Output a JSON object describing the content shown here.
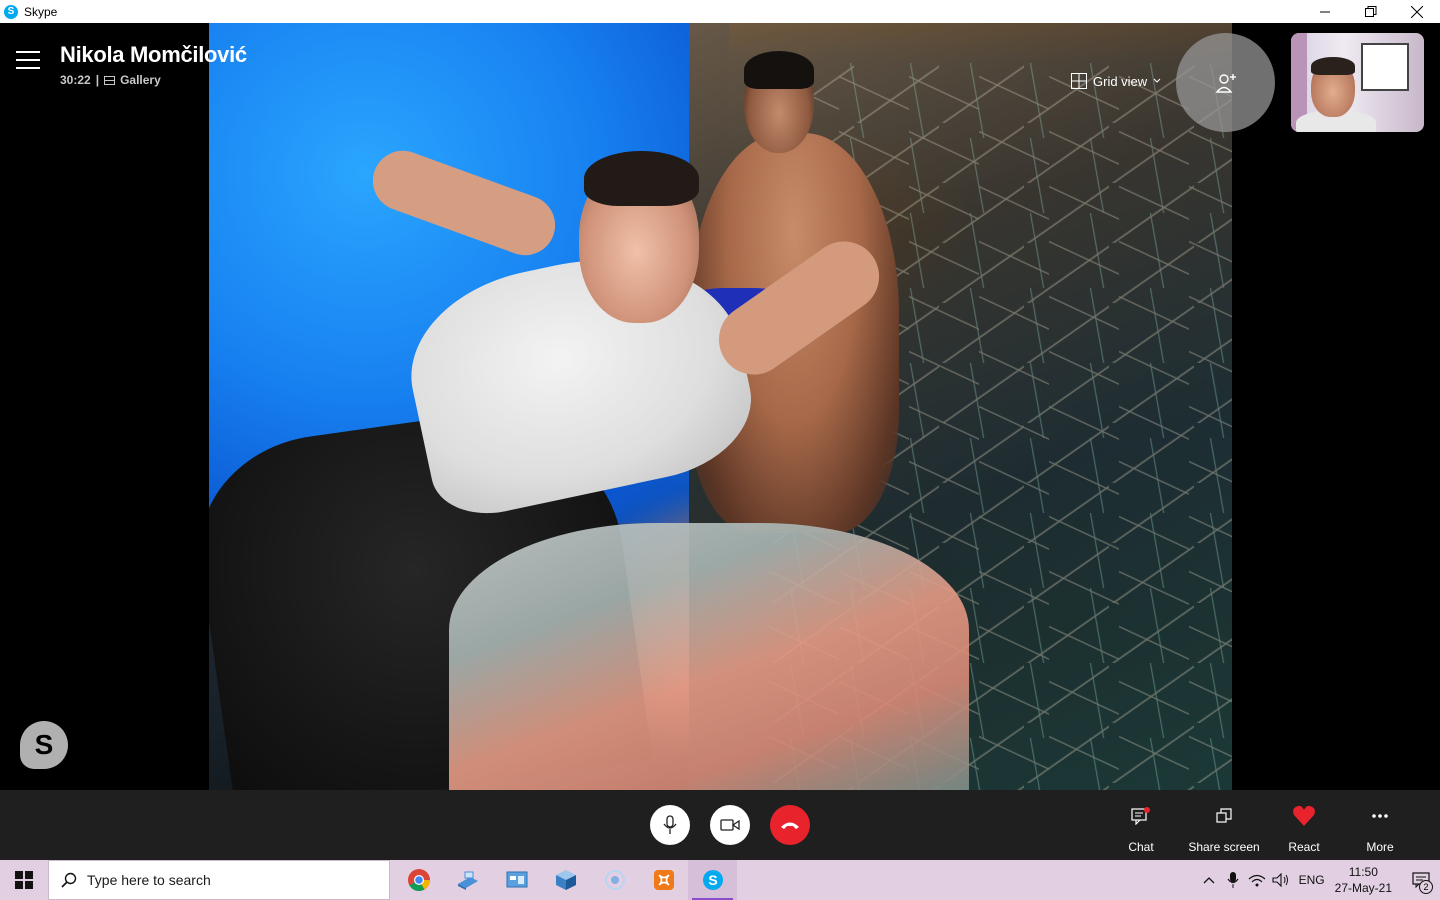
{
  "window": {
    "app_title": "Skype",
    "colors": {
      "end_call": "#e8232b",
      "react_heart": "#e8232b",
      "taskbar": "#e2d0e2",
      "control_bar": "#1f1f1f"
    }
  },
  "call": {
    "caller_name": "Nikola Momčilović",
    "duration": "30:22",
    "separator": "|",
    "layout_label": "Gallery",
    "grid_view_label": "Grid view"
  },
  "controls": {
    "actions": {
      "chat": "Chat",
      "share_screen": "Share screen",
      "react": "React",
      "more": "More"
    }
  },
  "taskbar": {
    "search_placeholder": "Type here to search",
    "apps": [
      "chrome-icon",
      "folder-icon",
      "control-panel-icon",
      "3d-box-icon",
      "cortana-circle-icon",
      "app-orange-icon",
      "skype-icon"
    ],
    "language": "ENG",
    "time": "11:50",
    "date": "27-May-21",
    "notifications_count": "2"
  }
}
